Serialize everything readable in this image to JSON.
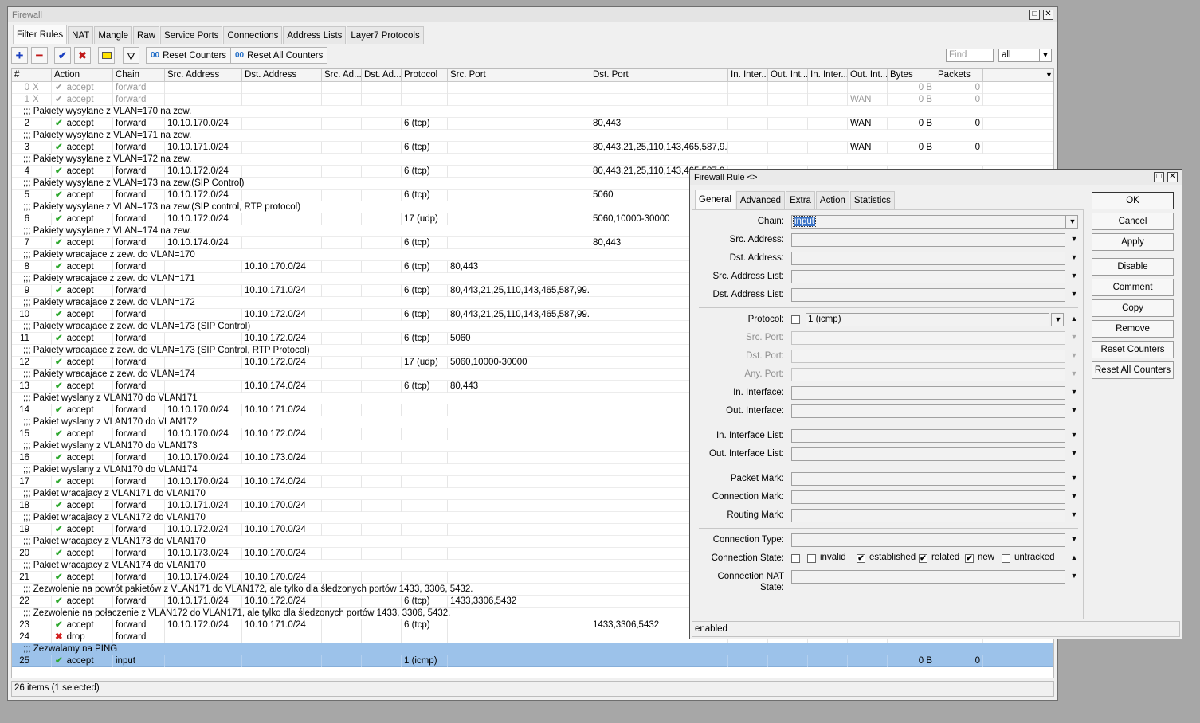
{
  "firewall": {
    "title": "Firewall",
    "tabs": [
      "Filter Rules",
      "NAT",
      "Mangle",
      "Raw",
      "Service Ports",
      "Connections",
      "Address Lists",
      "Layer7 Protocols"
    ],
    "active_tab": "Filter Rules",
    "toolbar": {
      "reset_counters": "Reset Counters",
      "reset_all_counters": "Reset All Counters",
      "find_placeholder": "Find",
      "filter_value": "all"
    },
    "columns": [
      "#",
      "Action",
      "Chain",
      "Src. Address",
      "Dst. Address",
      "Src. Ad...",
      "Dst. Ad...",
      "Protocol",
      "Src. Port",
      "Dst. Port",
      "In. Inter...",
      "Out. Int...",
      "In. Inter...",
      "Out. Int...",
      "Bytes",
      "Packets"
    ],
    "rows": [
      {
        "type": "rule",
        "disabled": true,
        "num": "0",
        "flag": "X",
        "action": "accept",
        "chain": "forward",
        "bytes": "0 B",
        "packets": "0"
      },
      {
        "type": "rule",
        "disabled": true,
        "num": "1",
        "flag": "X",
        "action": "accept",
        "chain": "forward",
        "out_list": "WAN",
        "bytes": "0 B",
        "packets": "0"
      },
      {
        "type": "comment",
        "text": ";;; Pakiety wysylane z VLAN=170 na zew."
      },
      {
        "type": "rule",
        "num": "2",
        "action": "accept",
        "chain": "forward",
        "src": "10.10.170.0/24",
        "proto": "6 (tcp)",
        "dport": "80,443",
        "out_list": "WAN",
        "bytes": "0 B",
        "packets": "0"
      },
      {
        "type": "comment",
        "text": ";;; Pakiety wysylane z VLAN=171 na zew."
      },
      {
        "type": "rule",
        "num": "3",
        "action": "accept",
        "chain": "forward",
        "src": "10.10.171.0/24",
        "proto": "6 (tcp)",
        "dport": "80,443,21,25,110,143,465,587,9...",
        "out_list": "WAN",
        "bytes": "0 B",
        "packets": "0"
      },
      {
        "type": "comment",
        "text": ";;; Pakiety wysylane z VLAN=172 na zew."
      },
      {
        "type": "rule",
        "num": "4",
        "action": "accept",
        "chain": "forward",
        "src": "10.10.172.0/24",
        "proto": "6 (tcp)",
        "dport": "80,443,21,25,110,143,465,587,9..."
      },
      {
        "type": "comment",
        "text": ";;; Pakiety wysylane z VLAN=173 na zew.(SIP Control)"
      },
      {
        "type": "rule",
        "num": "5",
        "action": "accept",
        "chain": "forward",
        "src": "10.10.172.0/24",
        "proto": "6 (tcp)",
        "dport": "5060"
      },
      {
        "type": "comment",
        "text": ";;; Pakiety wysylane z VLAN=173 na zew.(SIP control, RTP protocol)"
      },
      {
        "type": "rule",
        "num": "6",
        "action": "accept",
        "chain": "forward",
        "src": "10.10.172.0/24",
        "proto": "17 (udp)",
        "dport": "5060,10000-30000"
      },
      {
        "type": "comment",
        "text": ";;; Pakiety wysylane z VLAN=174 na zew."
      },
      {
        "type": "rule",
        "num": "7",
        "action": "accept",
        "chain": "forward",
        "src": "10.10.174.0/24",
        "proto": "6 (tcp)",
        "dport": "80,443"
      },
      {
        "type": "comment",
        "text": ";;; Pakiety wracajace z zew. do VLAN=170"
      },
      {
        "type": "rule",
        "num": "8",
        "action": "accept",
        "chain": "forward",
        "dst": "10.10.170.0/24",
        "proto": "6 (tcp)",
        "sport": "80,443"
      },
      {
        "type": "comment",
        "text": ";;; Pakiety wracajace z zew. do VLAN=171"
      },
      {
        "type": "rule",
        "num": "9",
        "action": "accept",
        "chain": "forward",
        "dst": "10.10.171.0/24",
        "proto": "6 (tcp)",
        "sport": "80,443,21,25,110,143,465,587,99..."
      },
      {
        "type": "comment",
        "text": ";;; Pakiety wracajace z zew. do VLAN=172"
      },
      {
        "type": "rule",
        "num": "10",
        "action": "accept",
        "chain": "forward",
        "dst": "10.10.172.0/24",
        "proto": "6 (tcp)",
        "sport": "80,443,21,25,110,143,465,587,99..."
      },
      {
        "type": "comment",
        "text": ";;; Pakiety wracajace z zew. do VLAN=173 (SIP Control)"
      },
      {
        "type": "rule",
        "num": "11",
        "action": "accept",
        "chain": "forward",
        "dst": "10.10.172.0/24",
        "proto": "6 (tcp)",
        "sport": "5060"
      },
      {
        "type": "comment",
        "text": ";;; Pakiety wracajace z zew. do VLAN=173 (SIP Control, RTP Protocol)"
      },
      {
        "type": "rule",
        "num": "12",
        "action": "accept",
        "chain": "forward",
        "dst": "10.10.172.0/24",
        "proto": "17 (udp)",
        "sport": "5060,10000-30000"
      },
      {
        "type": "comment",
        "text": ";;; Pakiety wracajace z zew. do VLAN=174"
      },
      {
        "type": "rule",
        "num": "13",
        "action": "accept",
        "chain": "forward",
        "dst": "10.10.174.0/24",
        "proto": "6 (tcp)",
        "sport": "80,443"
      },
      {
        "type": "comment",
        "text": ";;; Pakiet wyslany z VLAN170 do VLAN171"
      },
      {
        "type": "rule",
        "num": "14",
        "action": "accept",
        "chain": "forward",
        "src": "10.10.170.0/24",
        "dst": "10.10.171.0/24"
      },
      {
        "type": "comment",
        "text": ";;; Pakiet wyslany z VLAN170 do VLAN172"
      },
      {
        "type": "rule",
        "num": "15",
        "action": "accept",
        "chain": "forward",
        "src": "10.10.170.0/24",
        "dst": "10.10.172.0/24"
      },
      {
        "type": "comment",
        "text": ";;; Pakiet wyslany z VLAN170 do VLAN173"
      },
      {
        "type": "rule",
        "num": "16",
        "action": "accept",
        "chain": "forward",
        "src": "10.10.170.0/24",
        "dst": "10.10.173.0/24"
      },
      {
        "type": "comment",
        "text": ";;; Pakiet wyslany z VLAN170 do VLAN174"
      },
      {
        "type": "rule",
        "num": "17",
        "action": "accept",
        "chain": "forward",
        "src": "10.10.170.0/24",
        "dst": "10.10.174.0/24"
      },
      {
        "type": "comment",
        "text": ";;; Pakiet wracajacy z VLAN171 do VLAN170"
      },
      {
        "type": "rule",
        "num": "18",
        "action": "accept",
        "chain": "forward",
        "src": "10.10.171.0/24",
        "dst": "10.10.170.0/24"
      },
      {
        "type": "comment",
        "text": ";;; Pakiet wracajacy z VLAN172 do VLAN170"
      },
      {
        "type": "rule",
        "num": "19",
        "action": "accept",
        "chain": "forward",
        "src": "10.10.172.0/24",
        "dst": "10.10.170.0/24"
      },
      {
        "type": "comment",
        "text": ";;; Pakiet wracajacy z VLAN173 do VLAN170"
      },
      {
        "type": "rule",
        "num": "20",
        "action": "accept",
        "chain": "forward",
        "src": "10.10.173.0/24",
        "dst": "10.10.170.0/24"
      },
      {
        "type": "comment",
        "text": ";;; Pakiet wracajacy z VLAN174 do VLAN170"
      },
      {
        "type": "rule",
        "num": "21",
        "action": "accept",
        "chain": "forward",
        "src": "10.10.174.0/24",
        "dst": "10.10.170.0/24"
      },
      {
        "type": "comment",
        "text": ";;; Zezwolenie na powrót pakietów z VLAN171 do VLAN172, ale tylko dla śledzonych portów 1433, 3306, 5432."
      },
      {
        "type": "rule",
        "num": "22",
        "action": "accept",
        "chain": "forward",
        "src": "10.10.171.0/24",
        "dst": "10.10.172.0/24",
        "proto": "6 (tcp)",
        "sport": "1433,3306,5432"
      },
      {
        "type": "comment",
        "text": ";;; Zezwolenie na połaczenie z VLAN172 do VLAN171, ale tylko dla śledzonych portów 1433, 3306, 5432."
      },
      {
        "type": "rule",
        "num": "23",
        "action": "accept",
        "chain": "forward",
        "src": "10.10.172.0/24",
        "dst": "10.10.171.0/24",
        "proto": "6 (tcp)",
        "dport": "1433,3306,5432"
      },
      {
        "type": "rule",
        "num": "24",
        "action": "drop",
        "chain": "forward"
      },
      {
        "type": "comment",
        "selected": true,
        "text": ";;; Zezwalamy na PING"
      },
      {
        "type": "rule",
        "selected": true,
        "num": "25",
        "action": "accept",
        "chain": "input",
        "proto": "1 (icmp)",
        "bytes": "0 B",
        "packets": "0"
      }
    ],
    "status": "26 items (1 selected)"
  },
  "rule_dialog": {
    "title": "Firewall Rule <>",
    "tabs": [
      "General",
      "Advanced",
      "Extra",
      "Action",
      "Statistics"
    ],
    "active_tab": "General",
    "chain_label": "Chain:",
    "chain_value": "input",
    "labels": {
      "src_address": "Src. Address:",
      "dst_address": "Dst. Address:",
      "src_address_list": "Src. Address List:",
      "dst_address_list": "Dst. Address List:",
      "protocol": "Protocol:",
      "src_port": "Src. Port:",
      "dst_port": "Dst. Port:",
      "any_port": "Any. Port:",
      "in_interface": "In. Interface:",
      "out_interface": "Out. Interface:",
      "in_interface_list": "In. Interface List:",
      "out_interface_list": "Out. Interface List:",
      "packet_mark": "Packet Mark:",
      "connection_mark": "Connection Mark:",
      "routing_mark": "Routing Mark:",
      "connection_type": "Connection Type:",
      "connection_state": "Connection State:",
      "connection_nat_state": "Connection NAT State:"
    },
    "protocol_value": "1 (icmp)",
    "states": [
      {
        "label": "invalid",
        "checked": false
      },
      {
        "label": "established",
        "checked": true
      },
      {
        "label": "related",
        "checked": true
      },
      {
        "label": "new",
        "checked": true
      },
      {
        "label": "untracked",
        "checked": false
      }
    ],
    "buttons": [
      "OK",
      "Cancel",
      "Apply",
      "Disable",
      "Comment",
      "Copy",
      "Remove",
      "Reset Counters",
      "Reset All Counters"
    ],
    "status": "enabled"
  }
}
